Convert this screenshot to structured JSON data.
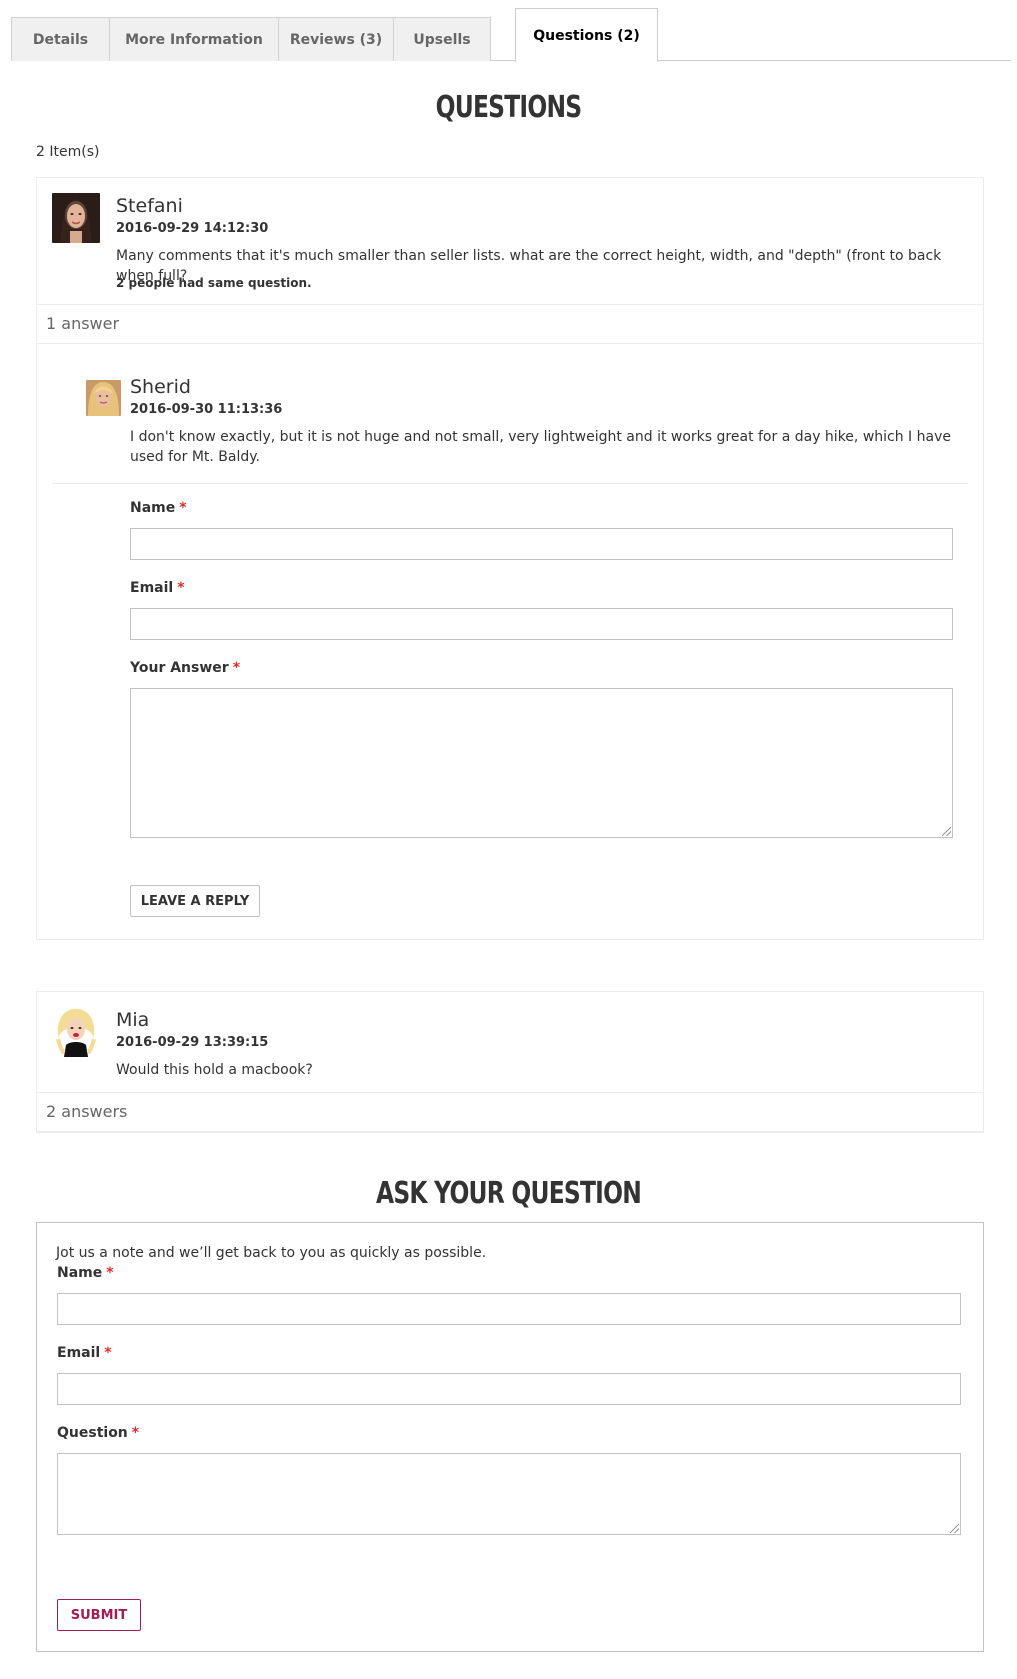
{
  "tabs": [
    {
      "label": "Details",
      "active": false
    },
    {
      "label": "More Information",
      "active": false
    },
    {
      "label": "Reviews (3)",
      "active": false
    },
    {
      "label": "Upsells",
      "active": false
    },
    {
      "label": "Questions (2)",
      "active": true
    }
  ],
  "questions_section": {
    "title": "QUESTIONS",
    "items_count": "2 Item(s)"
  },
  "questions": [
    {
      "author": "Stefani",
      "datetime": "2016-09-29 14:12:30",
      "text": "Many comments that it's much smaller than seller lists. what are the correct height, width, and \"depth\" (front to back when full?",
      "same_question": "2 people had same question.",
      "answers_label": "1 answer",
      "answers": [
        {
          "author": "Sherid",
          "datetime": "2016-09-30 11:13:36",
          "text": "I don't know exactly, but it is not huge and not small, very lightweight and it works great for a day hike, which I have used for Mt. Baldy."
        }
      ],
      "reply_form": {
        "name_label": "Name",
        "email_label": "Email",
        "answer_label": "Your Answer",
        "required_mark": "*",
        "button_label": "LEAVE A REPLY"
      }
    },
    {
      "author": "Mia",
      "datetime": "2016-09-29 13:39:15",
      "text": "Would this hold a macbook?",
      "answers_label": "2 answers"
    }
  ],
  "ask_section": {
    "title": "ASK YOUR QUESTION",
    "intro": "Jot us a note and we’ll get back to you as quickly as possible.",
    "name_label": "Name",
    "email_label": "Email",
    "question_label": "Question",
    "required_mark": "*",
    "submit_label": "SUBMIT"
  },
  "colors": {
    "required": "#e02b27",
    "submit_accent": "#a01d58",
    "border": "#c2c2c2"
  }
}
